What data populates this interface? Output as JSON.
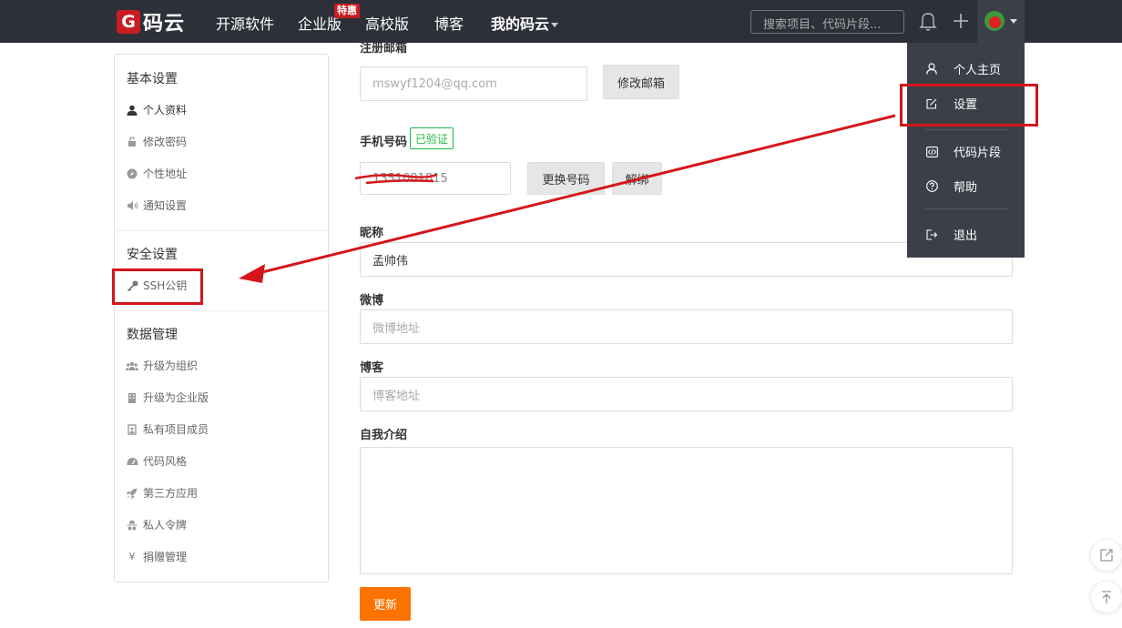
{
  "brand": {
    "logo_letter": "G",
    "name": "码云"
  },
  "nav": {
    "items": [
      "开源软件",
      "企业版",
      "高校版",
      "博客",
      "我的码云"
    ],
    "badge": "特惠",
    "search_placeholder": "搜索项目、代码片段..."
  },
  "sidebar": {
    "sections": [
      {
        "title": "基本设置",
        "items": [
          "个人资料",
          "修改密码",
          "个性地址",
          "通知设置"
        ]
      },
      {
        "title": "安全设置",
        "items": [
          "SSH公钥"
        ]
      },
      {
        "title": "数据管理",
        "items": [
          "升级为组织",
          "升级为企业版",
          "私有项目成员",
          "代码风格",
          "第三方应用",
          "私人令牌",
          "捐赠管理"
        ]
      }
    ]
  },
  "form": {
    "email_label": "注册邮箱",
    "email_value": "mswyf1204@qq.com",
    "change_email": "修改邮箱",
    "phone_label": "手机号码",
    "verified": "已验证",
    "phone_value": "1351081815",
    "change_phone": "更换号码",
    "unbind": "解绑",
    "nickname_label": "昵称",
    "nickname_value": "孟帅伟",
    "weibo_label": "微博",
    "weibo_placeholder": "微博地址",
    "blog_label": "博客",
    "blog_placeholder": "博客地址",
    "intro_label": "自我介绍",
    "update": "更新"
  },
  "dropdown": {
    "items": [
      "个人主页",
      "设置",
      "代码片段",
      "帮助",
      "退出"
    ]
  },
  "colors": {
    "nav_bg": "#2d3038",
    "brand_red": "#c71d23",
    "accent_orange": "#fe7300",
    "verified_green": "#21ba45",
    "annotation_red": "#d4161a"
  }
}
